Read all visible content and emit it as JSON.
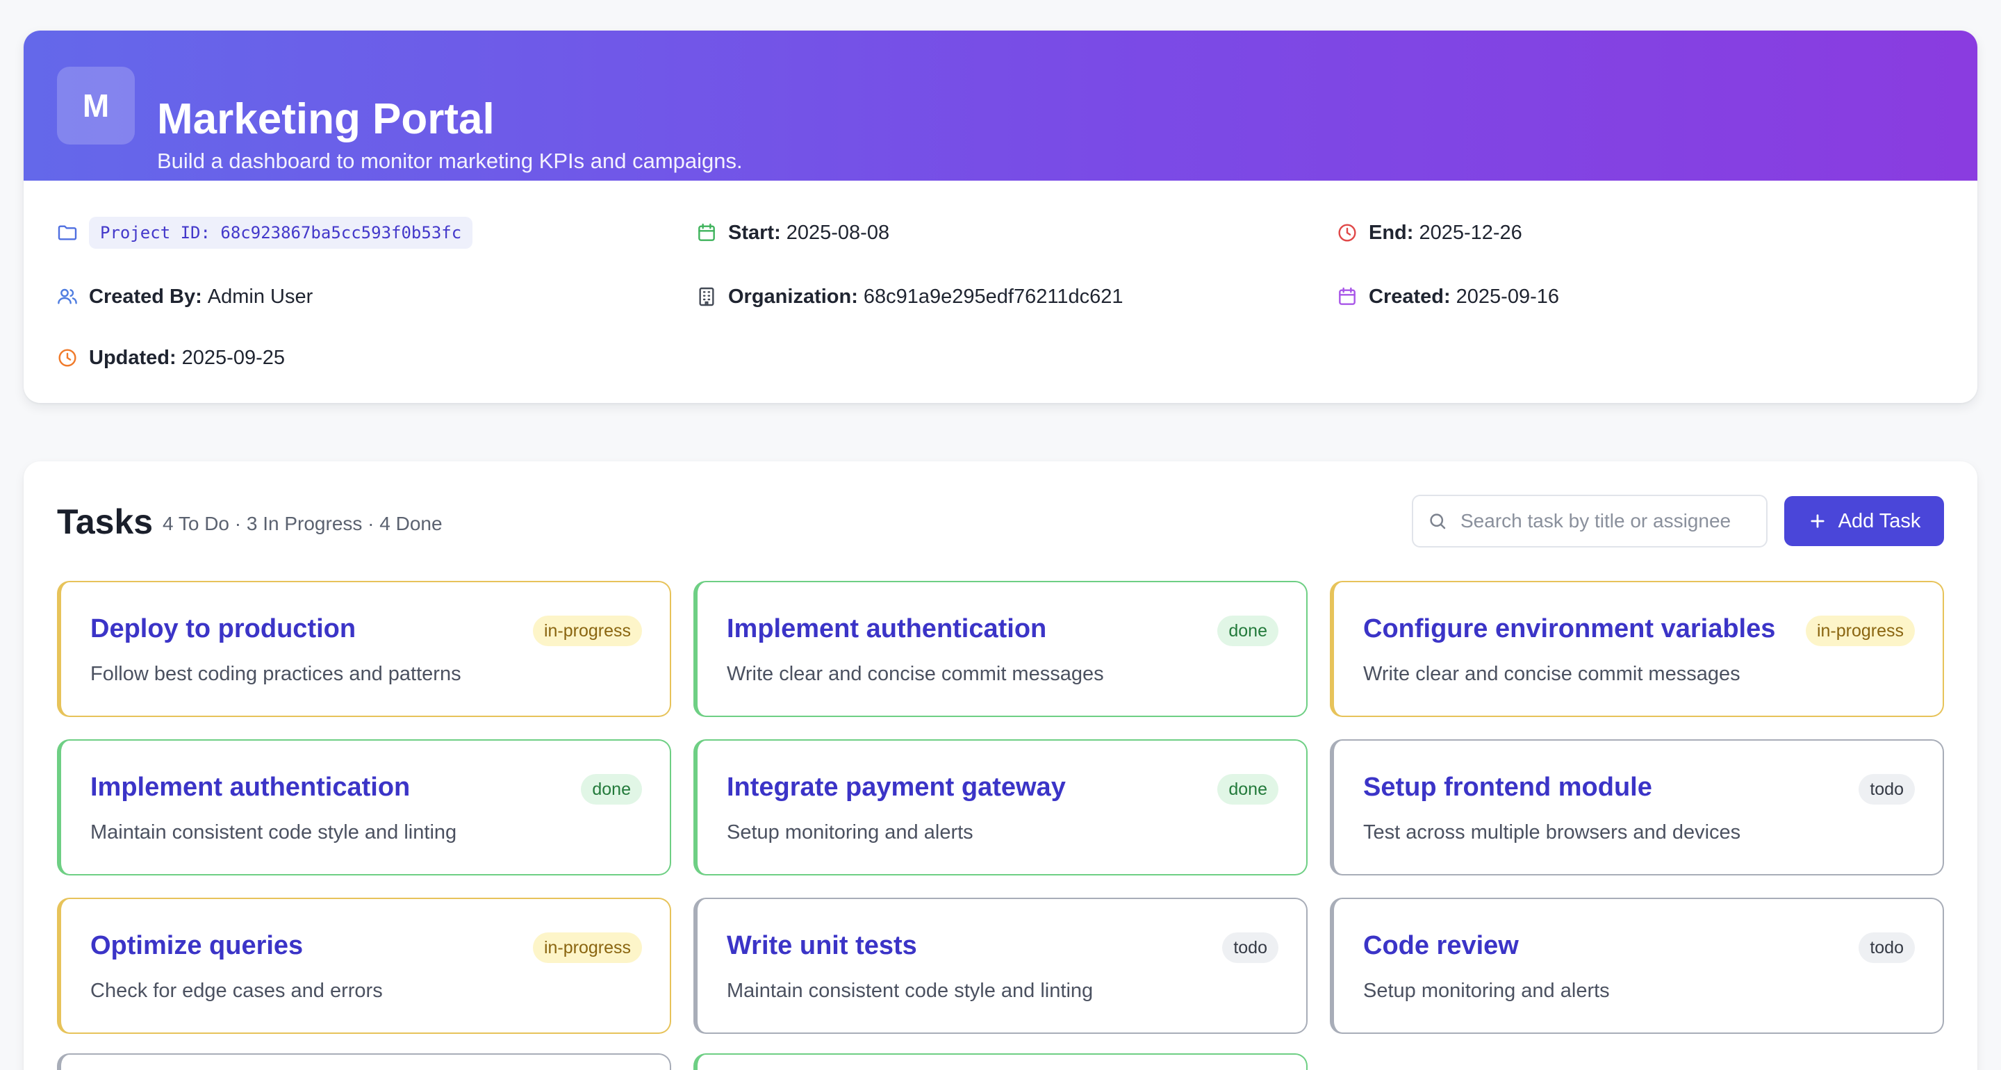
{
  "project": {
    "avatar_letter": "M",
    "title": "Marketing Portal",
    "subtitle": "Build a dashboard to monitor marketing KPIs and campaigns.",
    "project_id_label": "Project ID: 68c923867ba5cc593f0b53fc",
    "start_label": "Start:",
    "start_value": "2025-08-08",
    "end_label": "End:",
    "end_value": "2025-12-26",
    "created_by_label": "Created By:",
    "created_by_value": "Admin User",
    "organization_label": "Organization:",
    "organization_value": "68c91a9e295edf76211dc621",
    "created_label": "Created:",
    "created_value": "2025-09-16",
    "updated_label": "Updated:",
    "updated_value": "2025-09-25"
  },
  "tasks": {
    "title": "Tasks",
    "summary": "4 To Do · 3 In Progress · 4 Done",
    "search_placeholder": "Search task by title or assignee",
    "add_label": "Add Task",
    "items": [
      {
        "title": "Deploy to production",
        "description": "Follow best coding practices and patterns",
        "status": "in-progress"
      },
      {
        "title": "Implement authentication",
        "description": "Write clear and concise commit messages",
        "status": "done"
      },
      {
        "title": "Configure environment variables",
        "description": "Write clear and concise commit messages",
        "status": "in-progress"
      },
      {
        "title": "Implement authentication",
        "description": "Maintain consistent code style and linting",
        "status": "done"
      },
      {
        "title": "Integrate payment gateway",
        "description": "Setup monitoring and alerts",
        "status": "done"
      },
      {
        "title": "Setup frontend module",
        "description": "Test across multiple browsers and devices",
        "status": "todo"
      },
      {
        "title": "Optimize queries",
        "description": "Check for edge cases and errors",
        "status": "in-progress"
      },
      {
        "title": "Write unit tests",
        "description": "Maintain consistent code style and linting",
        "status": "todo"
      },
      {
        "title": "Code review",
        "description": "Setup monitoring and alerts",
        "status": "todo"
      }
    ]
  },
  "icons": {
    "project_id": "folder-icon",
    "start": "calendar-icon",
    "end": "clock-icon",
    "created_by": "users-icon",
    "organization": "building-icon",
    "created": "calendar-icon",
    "updated": "clock-icon",
    "search": "search-icon",
    "add": "plus-icon"
  },
  "colors": {
    "banner_start": "#6468ea",
    "banner_end": "#8a3ce0",
    "accent": "#4a46d9",
    "in_progress": "#e7c35a",
    "done": "#6ecf84",
    "todo": "#a8adb8"
  }
}
